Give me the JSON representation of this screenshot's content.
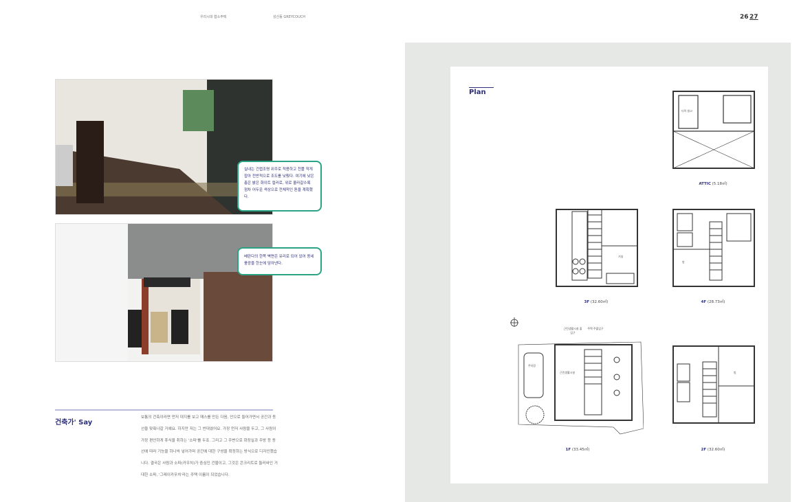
{
  "header": {
    "left_section": "우리시대 협소주택",
    "right_section": "성산동 GREYCOUCH",
    "page_left": "26",
    "page_right": "27"
  },
  "photos": {
    "callout_1": "실내는 건렵조명 위주로 적용하고 천플 작게 잡아 전반적으로 조도를 낮췄다. 여기에 낮은 층은 밝은 화이트 컬러로, 위로 올라갈수록 점차 어두운 색상으로 전체적인 톤을 계획했다.",
    "callout_2": "베란다의 한쪽 벽면은 유리로 되어 있어 동네 풍광을 한눈에 담아낸다."
  },
  "say": {
    "title": "건축가' Say",
    "body": "보통의 건축이라면 먼저 대지를 보고 매스를 만든 다음, 안으로 들어가면서 공간과 동선을 맞춰나갈 거예요. 하지만 저는 그 반대였어요. 가장 먼저 사람을 두고, 그 사람이 가장 편안하게 휴식을 취하는 '소파'를 두죠. 그리고 그 주변으로 화장실과 주방 등 동선에 따라 기능을 하나씩 넣어가며 공간에 대한 구성을 확정하는 방식으로 디자인했습니다. 결국은 사람과 소파(카우치)가 중심인 건물이고, 그것은 콘크리트로 둘러싸인 거대한 소파, '그레이카우치'라는 주택 이름이 되었습니다."
  },
  "plan": {
    "title": "Plan",
    "floors": [
      {
        "name": "ATTIC",
        "area": "(5.18㎡)"
      },
      {
        "name": "3F",
        "area": "(32.60㎡)"
      },
      {
        "name": "4F",
        "area": "(28.73㎡)"
      },
      {
        "name": "1F",
        "area": "(33.45㎡)"
      },
      {
        "name": "2F",
        "area": "(32.60㎡)"
      }
    ],
    "entrance_1": "근린생활시설 출입구",
    "entrance_2": "주택 주출입구",
    "room_shop": "근린생활시설",
    "room_parking": "주차장",
    "room_living": "거실",
    "room_bed": "방",
    "room_storage": "다락 창고"
  }
}
